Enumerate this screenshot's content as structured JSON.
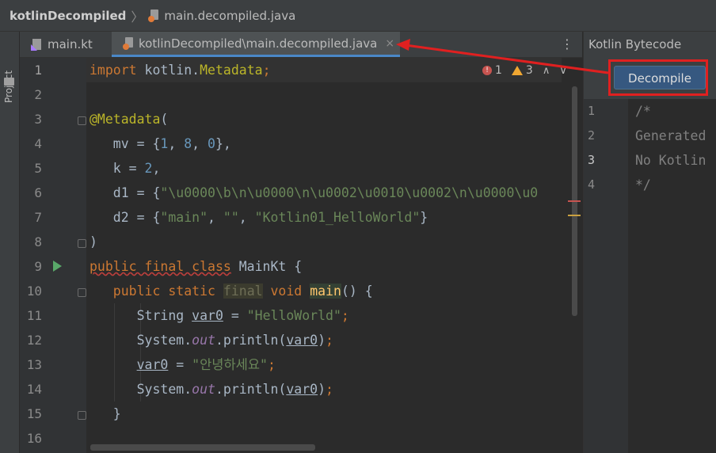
{
  "breadcrumb": {
    "project": "kotlinDecompiled",
    "separator": "〉",
    "file": "main.decompiled.java"
  },
  "sidebar": {
    "project_label": "Project"
  },
  "tabs": [
    {
      "label": "main.kt",
      "icon": "kotlin-file-icon"
    },
    {
      "label": "kotlinDecompiled\\main.decompiled.java",
      "icon": "java-file-icon",
      "active": true,
      "close": "×"
    }
  ],
  "tab_menu": "⋮",
  "inspections": {
    "errors": "1",
    "warnings": "3",
    "error_glyph": "!",
    "prev": "∧",
    "next": "∨"
  },
  "line_numbers": [
    "1",
    "2",
    "3",
    "4",
    "5",
    "6",
    "7",
    "8",
    "9",
    "10",
    "11",
    "12",
    "13",
    "14",
    "15",
    "16"
  ],
  "code": {
    "l1_kw": "import",
    "l1_rest": " kotlin.",
    "l1_ann": "Metadata",
    "l1_semi": ";",
    "l3_ann": "@Metadata",
    "l3_rest": "(",
    "l4_a": "   mv = {",
    "l4_n1": "1",
    "l4_c1": ", ",
    "l4_n2": "8",
    "l4_c2": ", ",
    "l4_n3": "0",
    "l4_e": "},",
    "l5_a": "   k = ",
    "l5_n": "2",
    "l5_e": ",",
    "l6_a": "   d1 = {",
    "l6_s": "\"\\u0000\\b\\n\\u0000\\n\\u0002\\u0010\\u0002\\n\\u0000\\u0",
    "l7_a": "   d2 = {",
    "l7_s1": "\"main\"",
    "l7_c1": ", ",
    "l7_s2": "\"\"",
    "l7_c2": ", ",
    "l7_s3": "\"Kotlin01_HelloWorld\"",
    "l7_e": "}",
    "l8": ")",
    "l9_kw": "public final class",
    "l9_sp": " ",
    "l9_name": "MainKt",
    "l9_e": " {",
    "l10_kw1": "   public static",
    "l10_sp1": " ",
    "l10_final": "final",
    "l10_sp2": " ",
    "l10_void": "void",
    "l10_sp3": " ",
    "l10_main": "main",
    "l10_e": "() {",
    "l11_a": "      String ",
    "l11_var": "var0",
    "l11_b": " = ",
    "l11_s": "\"HelloWorld\"",
    "l11_semi": ";",
    "l12_a": "      System.",
    "l12_out": "out",
    "l12_b": ".println(",
    "l12_var": "var0",
    "l12_e": ")",
    "l12_semi": ";",
    "l13_a": "      ",
    "l13_var": "var0",
    "l13_b": " = ",
    "l13_s": "\"안녕하세요\"",
    "l13_semi": ";",
    "l14_a": "      System.",
    "l14_out": "out",
    "l14_b": ".println(",
    "l14_var": "var0",
    "l14_e": ")",
    "l14_semi": ";",
    "l15": "   }"
  },
  "right_panel": {
    "title": "Kotlin Bytecode",
    "decompile_label": "Decompile",
    "line_numbers": [
      "1",
      "2",
      "3",
      "4"
    ],
    "lines": [
      "/*",
      "Generated",
      "No Kotlin",
      "*/"
    ]
  },
  "colors": {
    "accent": "#4a88c7",
    "annotation_red": "#e02020",
    "keyword": "#cc7832",
    "string": "#6a8759",
    "number": "#6897bb"
  }
}
